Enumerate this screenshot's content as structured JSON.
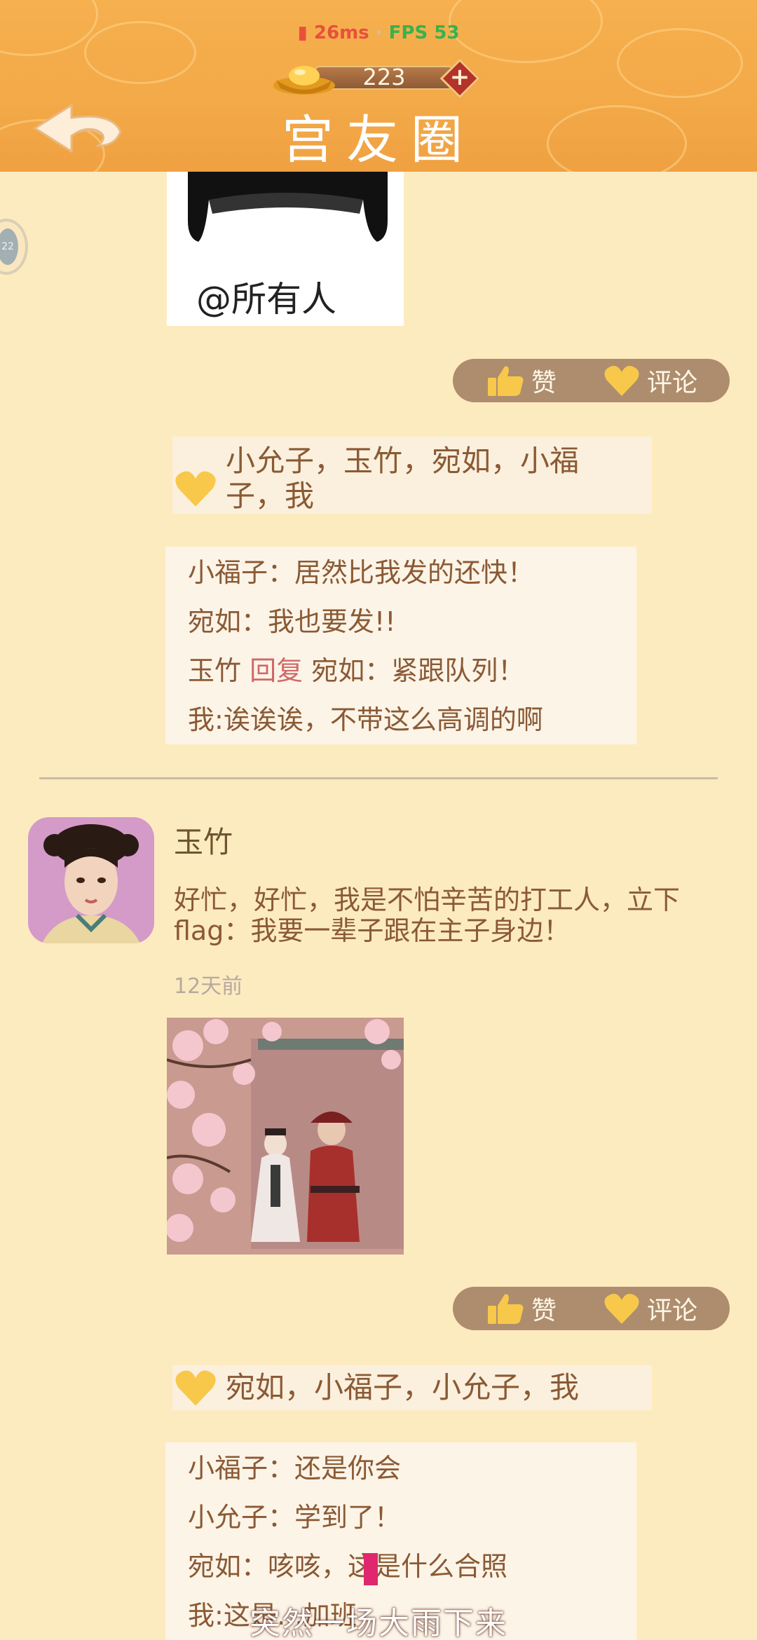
{
  "status": {
    "ping": "26ms",
    "separator": "·",
    "fps": "FPS 53"
  },
  "header": {
    "title": "宫友圈",
    "gold_amount": "223",
    "back_icon": "back-arrow-icon",
    "add_icon": "plus-icon"
  },
  "side_handle": {
    "label": "22"
  },
  "post1": {
    "image_caption": "@所有人",
    "actions": {
      "like": "赞",
      "comment": "评论"
    },
    "likes": "小允子，玉竹，宛如，小福子，我",
    "comments": [
      {
        "author": "小福子",
        "reply_word": "",
        "reply_to": "",
        "text": "居然比我发的还快！"
      },
      {
        "author": "宛如",
        "reply_word": "",
        "reply_to": "",
        "text": "我也要发!!"
      },
      {
        "author": "玉竹",
        "reply_word": "回复",
        "reply_to": "宛如",
        "text": "紧跟队列！"
      },
      {
        "author": "我",
        "reply_word": "",
        "reply_to": "",
        "text": "诶诶诶，不带这么高调的啊"
      }
    ]
  },
  "post2": {
    "author": "玉竹",
    "text": "好忙，好忙，我是不怕辛苦的打工人，立下flag：我要一辈子跟在主子身边！",
    "time": "12天前",
    "actions": {
      "like": "赞",
      "comment": "评论"
    },
    "likes": "宛如，小福子，小允子，我",
    "comments": [
      {
        "author": "小福子",
        "text": "还是你会"
      },
      {
        "author": "小允子",
        "text": "学到了！"
      },
      {
        "author": "宛如",
        "text": "咳咳，这是什么合照"
      },
      {
        "author": "我",
        "text": "这是…加班"
      }
    ]
  },
  "subtitle": "突然一场大雨下来",
  "colors": {
    "header": "#f3a947",
    "background": "#fdebc0",
    "pill": "#ad8d6e",
    "text": "#8a5a35",
    "reply": "#d06868",
    "heart": "#f8c84a"
  }
}
